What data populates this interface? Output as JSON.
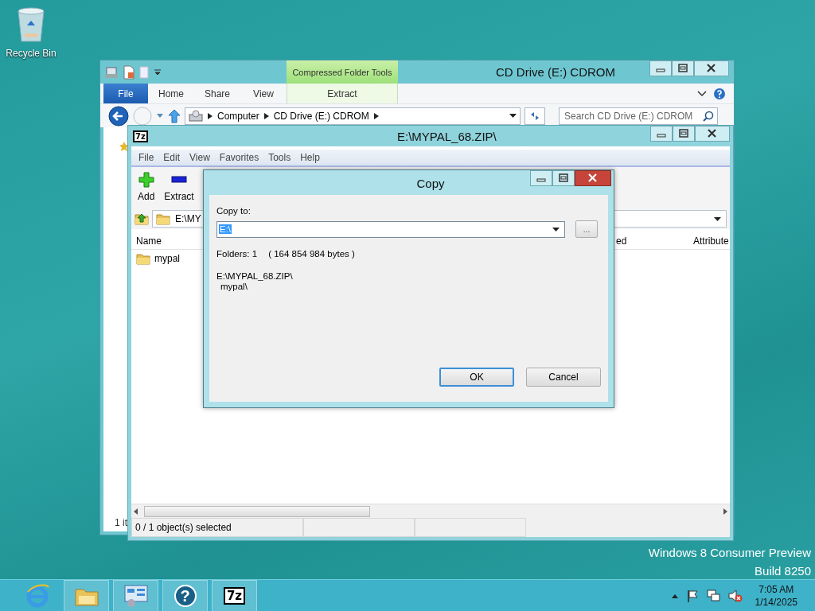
{
  "desktop": {
    "icons": [
      {
        "label": "Recycle Bin",
        "kind": "recycle-bin"
      }
    ],
    "branding": [
      "Windows 8 Consumer Preview",
      "Build 8250"
    ]
  },
  "explorer": {
    "title": "CD Drive (E:) CDROM",
    "context_group": "Compressed Folder Tools",
    "ribbon_tabs": [
      {
        "label": "File",
        "kind": "menu"
      },
      {
        "label": "Home",
        "kind": "tab"
      },
      {
        "label": "Share",
        "kind": "tab"
      },
      {
        "label": "View",
        "kind": "tab"
      },
      {
        "label": "Extract",
        "kind": "context"
      }
    ],
    "breadcrumb": [
      "Computer",
      "CD Drive (E:) CDROM"
    ],
    "search": {
      "placeholder": "Search CD Drive (E:) CDROM"
    },
    "status": "1 it"
  },
  "archive_window": {
    "icon": "7z",
    "title": "E:\\MYPAL_68.ZIP\\",
    "menu": [
      "File",
      "Edit",
      "View",
      "Favorites",
      "Tools",
      "Help"
    ],
    "toolbar": [
      {
        "label": "Add",
        "kind": "add"
      },
      {
        "label": "Extract",
        "kind": "extract"
      }
    ],
    "path": "E:\\MY",
    "columns": [
      "Name",
      "ed",
      "Attribute"
    ],
    "rows": [
      {
        "name": "mypal"
      }
    ],
    "status": "0 / 1 object(s) selected"
  },
  "dialog": {
    "title": "Copy",
    "copy_to_label": "Copy to:",
    "copy_to": {
      "value": "E:\\",
      "selected": true
    },
    "browse": "...",
    "folders": "Folders: 1",
    "size": "( 164 854 984 bytes )",
    "paths": [
      "E:\\MYPAL_68.ZIP\\",
      "mypal\\"
    ],
    "buttons": [
      {
        "label": "OK",
        "default": true
      },
      {
        "label": "Cancel",
        "default": false
      }
    ]
  },
  "taskbar": {
    "apps": [
      {
        "kind": "browser"
      },
      {
        "kind": "files"
      },
      {
        "kind": "control-panel"
      },
      {
        "kind": "help",
        "glyph": "?"
      },
      {
        "kind": "archiver",
        "glyph": "7z"
      }
    ],
    "clock": {
      "time": "7:05 AM",
      "date": "1/14/2025"
    }
  }
}
